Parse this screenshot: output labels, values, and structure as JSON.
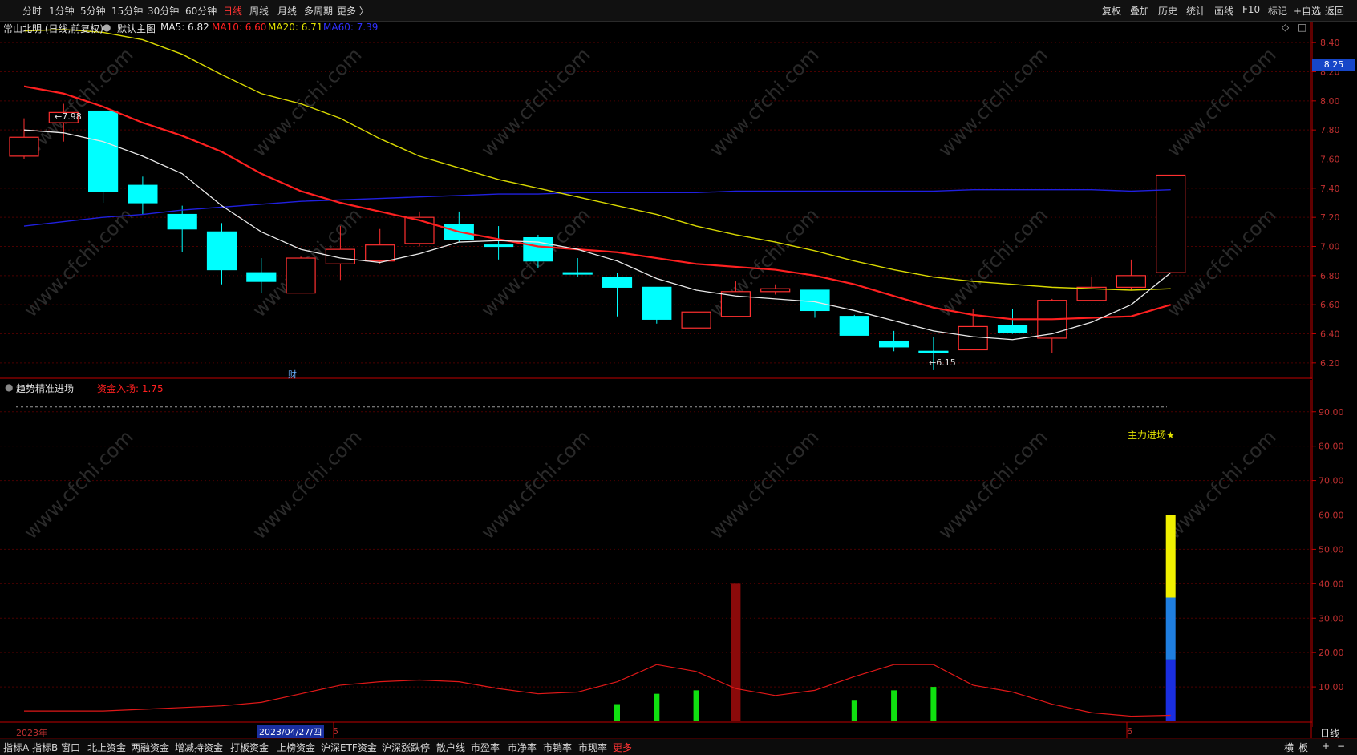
{
  "topbar": {
    "periods": [
      "分时",
      "1分钟",
      "5分钟",
      "15分钟",
      "30分钟",
      "60分钟",
      "日线",
      "周线",
      "月线",
      "多周期",
      "更多 〉"
    ],
    "active_period": "日线",
    "tools": [
      "复权",
      "叠加",
      "历史",
      "统计",
      "画线",
      "F10",
      "标记",
      "+自选",
      "返回"
    ]
  },
  "main_chart": {
    "title": "常山北明 (日线,前复权)",
    "indicator_name": "默认主图",
    "ma5_label": "MA5: 6.82",
    "ma10_label": "MA10: 6.60",
    "ma20_label": "MA20: 6.71",
    "ma60_label": "MA60: 7.39",
    "high_annotation": "←7.98",
    "low_annotation": "←6.15",
    "finance_marker": "财",
    "price_tag": "8.25"
  },
  "sub_chart": {
    "indicator_name": "趋势精准进场",
    "fund_label": "资金入场: 1.75",
    "signal_label": "主力进场★"
  },
  "colors": {
    "up": "#ff3030",
    "down": "#00ffff",
    "ma5": "#e8e8e8",
    "ma10": "#ff2020",
    "ma20": "#d8d800",
    "ma60": "#2020e0",
    "grid": "#4a0000",
    "axis": "#c00000"
  },
  "chart_data": [
    {
      "type": "candlestick",
      "title": "常山北明 (日线,前复权)",
      "ylim": [
        6.1,
        8.5
      ],
      "y_ticks": [
        "8.40",
        "8.20",
        "8.00",
        "7.80",
        "7.60",
        "7.40",
        "7.20",
        "7.00",
        "6.80",
        "6.60",
        "6.40",
        "6.20"
      ],
      "candles": [
        {
          "o": 7.62,
          "c": 7.75,
          "h": 7.88,
          "l": 7.6
        },
        {
          "o": 7.85,
          "c": 7.92,
          "h": 7.98,
          "l": 7.72
        },
        {
          "o": 7.93,
          "c": 7.38,
          "h": 7.93,
          "l": 7.3
        },
        {
          "o": 7.42,
          "c": 7.3,
          "h": 7.48,
          "l": 7.22
        },
        {
          "o": 7.22,
          "c": 7.12,
          "h": 7.28,
          "l": 6.96
        },
        {
          "o": 7.1,
          "c": 6.84,
          "h": 7.16,
          "l": 6.74
        },
        {
          "o": 6.82,
          "c": 6.76,
          "h": 6.92,
          "l": 6.68
        },
        {
          "o": 6.68,
          "c": 6.92,
          "h": 6.93,
          "l": 6.68
        },
        {
          "o": 6.88,
          "c": 6.98,
          "h": 7.14,
          "l": 6.77
        },
        {
          "o": 6.9,
          "c": 7.01,
          "h": 7.12,
          "l": 6.88
        },
        {
          "o": 7.02,
          "c": 7.2,
          "h": 7.24,
          "l": 7.0
        },
        {
          "o": 7.15,
          "c": 7.05,
          "h": 7.24,
          "l": 7.03
        },
        {
          "o": 7.01,
          "c": 7.0,
          "h": 7.14,
          "l": 6.91
        },
        {
          "o": 7.06,
          "c": 6.9,
          "h": 7.08,
          "l": 6.85
        },
        {
          "o": 6.82,
          "c": 6.81,
          "h": 6.92,
          "l": 6.79
        },
        {
          "o": 6.79,
          "c": 6.72,
          "h": 6.82,
          "l": 6.52
        },
        {
          "o": 6.72,
          "c": 6.5,
          "h": 6.72,
          "l": 6.47
        },
        {
          "o": 6.44,
          "c": 6.55,
          "h": 6.55,
          "l": 6.44
        },
        {
          "o": 6.52,
          "c": 6.69,
          "h": 6.76,
          "l": 6.52
        },
        {
          "o": 6.69,
          "c": 6.71,
          "h": 6.74,
          "l": 6.67
        },
        {
          "o": 6.7,
          "c": 6.56,
          "h": 6.7,
          "l": 6.51
        },
        {
          "o": 6.52,
          "c": 6.39,
          "h": 6.53,
          "l": 6.39
        },
        {
          "o": 6.35,
          "c": 6.31,
          "h": 6.42,
          "l": 6.28
        },
        {
          "o": 6.28,
          "c": 6.27,
          "h": 6.38,
          "l": 6.15
        },
        {
          "o": 6.29,
          "c": 6.45,
          "h": 6.57,
          "l": 6.29
        },
        {
          "o": 6.46,
          "c": 6.41,
          "h": 6.57,
          "l": 6.4
        },
        {
          "o": 6.37,
          "c": 6.63,
          "h": 6.64,
          "l": 6.27
        },
        {
          "o": 6.63,
          "c": 6.72,
          "h": 6.79,
          "l": 6.63
        },
        {
          "o": 6.72,
          "c": 6.8,
          "h": 6.91,
          "l": 6.7
        },
        {
          "o": 6.82,
          "c": 7.49,
          "h": 7.49,
          "l": 6.82
        }
      ],
      "ma5": [
        7.8,
        7.78,
        7.72,
        7.62,
        7.5,
        7.28,
        7.1,
        6.98,
        6.92,
        6.89,
        6.95,
        7.03,
        7.04,
        7.03,
        6.98,
        6.9,
        6.78,
        6.7,
        6.66,
        6.64,
        6.62,
        6.56,
        6.49,
        6.42,
        6.38,
        6.36,
        6.4,
        6.48,
        6.6,
        6.82
      ],
      "ma10": [
        8.1,
        8.05,
        7.96,
        7.85,
        7.76,
        7.65,
        7.5,
        7.38,
        7.3,
        7.24,
        7.18,
        7.1,
        7.05,
        7.0,
        6.98,
        6.96,
        6.92,
        6.88,
        6.86,
        6.84,
        6.8,
        6.74,
        6.66,
        6.58,
        6.53,
        6.5,
        6.5,
        6.51,
        6.52,
        6.6
      ],
      "ma20": [
        8.48,
        8.49,
        8.47,
        8.42,
        8.32,
        8.18,
        8.05,
        7.98,
        7.88,
        7.74,
        7.62,
        7.54,
        7.46,
        7.4,
        7.34,
        7.28,
        7.22,
        7.14,
        7.08,
        7.03,
        6.97,
        6.9,
        6.84,
        6.79,
        6.76,
        6.74,
        6.72,
        6.71,
        6.7,
        6.71
      ],
      "ma60": [
        7.14,
        7.17,
        7.2,
        7.22,
        7.25,
        7.27,
        7.29,
        7.31,
        7.32,
        7.33,
        7.34,
        7.35,
        7.36,
        7.36,
        7.37,
        7.37,
        7.37,
        7.37,
        7.38,
        7.38,
        7.38,
        7.38,
        7.38,
        7.38,
        7.39,
        7.39,
        7.39,
        7.39,
        7.38,
        7.39
      ]
    },
    {
      "type": "bar",
      "title": "趋势精准进场",
      "ylim": [
        0,
        96
      ],
      "y_ticks": [
        "90.00",
        "80.00",
        "70.00",
        "60.00",
        "50.00",
        "40.00",
        "30.00",
        "20.00",
        "10.00"
      ],
      "dashed_level": 90,
      "green_bars": [
        {
          "i": 15,
          "v": 5
        },
        {
          "i": 16,
          "v": 8
        },
        {
          "i": 17,
          "v": 9
        },
        {
          "i": 21,
          "v": 6
        },
        {
          "i": 22,
          "v": 9
        },
        {
          "i": 23,
          "v": 10
        }
      ],
      "darkred_bars": [
        {
          "i": 18,
          "v": 40
        }
      ],
      "stacked_bar": {
        "i": 29,
        "segments": [
          {
            "from": 0,
            "to": 18,
            "color": "#1a2ee0"
          },
          {
            "from": 18,
            "to": 36,
            "color": "#1f7ee0"
          },
          {
            "from": 36,
            "to": 60,
            "color": "#f0f000"
          }
        ]
      },
      "line": [
        3,
        3,
        3,
        3.5,
        4,
        4.5,
        5.5,
        8,
        10.5,
        11.5,
        12,
        11.5,
        9.5,
        8,
        8.5,
        11.5,
        16.5,
        14.5,
        9.5,
        7.5,
        9,
        13,
        16.5,
        16.5,
        10.5,
        8.5,
        5,
        2.5,
        1.5,
        1.75
      ]
    }
  ],
  "bottom_axis": {
    "year_label": "2023年",
    "date_label": "2023/04/27/四",
    "tick_5": "5",
    "tick_6": "6",
    "period_btn": "日线"
  },
  "bottombar": {
    "tabs": [
      "指标A",
      "指标B",
      "窗口",
      "北上资金",
      "两融资金",
      "增减持资金",
      "打板资金",
      "上榜资金",
      "沪深ETF资金",
      "沪深涨跌停",
      "散户线",
      "市盈率",
      "市净率",
      "市销率",
      "市现率",
      "更多"
    ],
    "active_tab": "更多",
    "right": [
      "横",
      "板",
      "+",
      "−"
    ]
  },
  "watermark": "www.cfchi.com"
}
